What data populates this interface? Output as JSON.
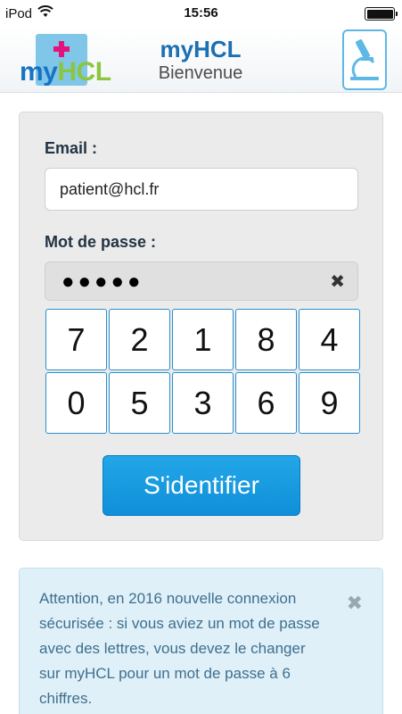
{
  "status_bar": {
    "carrier": "iPod",
    "time": "15:56",
    "icons": [
      "wifi-icon",
      "battery-icon"
    ]
  },
  "header": {
    "logo": {
      "my": "my",
      "hcl": "HCL"
    },
    "title": "myHCL",
    "subtitle": "Bienvenue",
    "right_icon": "microscope-icon"
  },
  "login": {
    "email_label": "Email :",
    "email_value": "patient@hcl.fr",
    "password_label": "Mot de passe :",
    "password_dots": "●●●●●",
    "clear_icon": "✖",
    "keypad": [
      [
        "7",
        "2",
        "1",
        "8",
        "4"
      ],
      [
        "0",
        "5",
        "3",
        "6",
        "9"
      ]
    ],
    "submit_label": "S'identifier"
  },
  "notice": {
    "text": "Attention, en 2016 nouvelle connexion sécurisée : si vous aviez un mot de passe avec des lettres, vous devez le changer sur myHCL pour un mot de passe à 6 chiffres.",
    "close_icon": "✖"
  },
  "colors": {
    "brand_blue": "#1b6fb3",
    "button_blue": "#1a9be0",
    "logo_pink": "#e4117e",
    "logo_green": "#8cc63f",
    "notice_bg": "#dff0f9"
  }
}
